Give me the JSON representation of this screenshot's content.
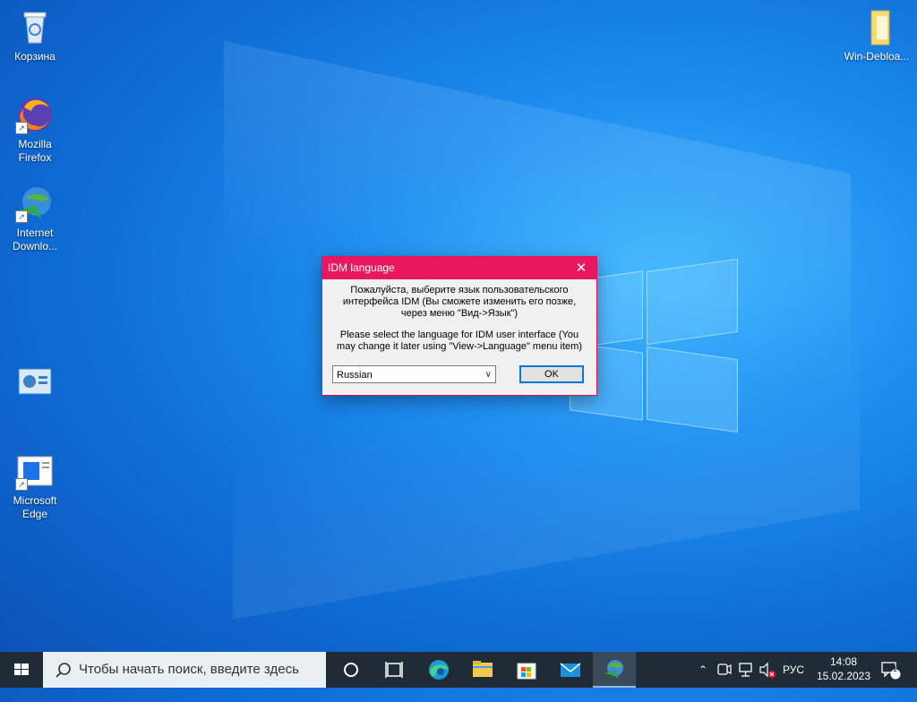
{
  "desktop": {
    "icons": [
      {
        "label": "Корзина",
        "icon": "recycle-bin-icon"
      },
      {
        "label": "Mozilla Firefox",
        "icon": "firefox-icon"
      },
      {
        "label": "Internet Downlo...",
        "icon": "idm-icon"
      },
      {
        "label": "",
        "icon": "control-panel-icon"
      },
      {
        "label": "Microsoft Edge",
        "icon": "edge-legacy-icon"
      },
      {
        "label": "Win-Debloa...",
        "icon": "folder-icon"
      }
    ]
  },
  "dialog": {
    "title": "IDM language",
    "close_glyph": "✕",
    "message_ru": "Пожалуйста, выберите язык пользовательского интерфейса IDM (Вы сможете изменить его позже, через меню \"Вид->Язык\")",
    "message_en": "Please select the language for IDM user interface (You may change it later using \"View->Language\" menu item)",
    "language_selected": "Russian",
    "ok_label": "OK"
  },
  "taskbar": {
    "search_placeholder": "Чтобы начать поиск, введите здесь",
    "apps": [
      "cortana-icon",
      "task-view-icon",
      "edge-icon",
      "file-explorer-icon",
      "store-icon",
      "mail-icon",
      "idm-icon"
    ],
    "tray": {
      "language": "РУС",
      "time": "14:08",
      "date": "15.02.2023",
      "notifications_count": "1"
    }
  },
  "colors": {
    "accent_title": "#e9175d",
    "taskbar": "#1f2b36"
  }
}
